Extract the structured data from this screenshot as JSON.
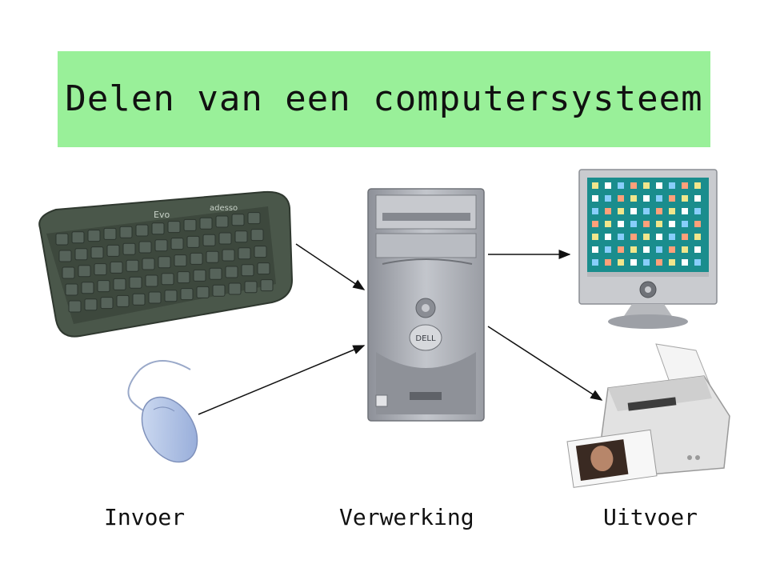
{
  "title": "Delen van een computersysteem",
  "labels": {
    "input": "Invoer",
    "processing": "Verwerking",
    "output": "Uitvoer"
  },
  "devices": {
    "keyboard_brand": "Evo",
    "keyboard_brand2": "adesso",
    "tower_brand": "DELL"
  },
  "colors": {
    "title_background": "#99f099",
    "keyboard": "#4c5a4c",
    "tower": "#a9acb3",
    "monitor_screen": "#1b8a8a",
    "mouse": "#aabfe3",
    "printer": "#e6e6e6"
  }
}
